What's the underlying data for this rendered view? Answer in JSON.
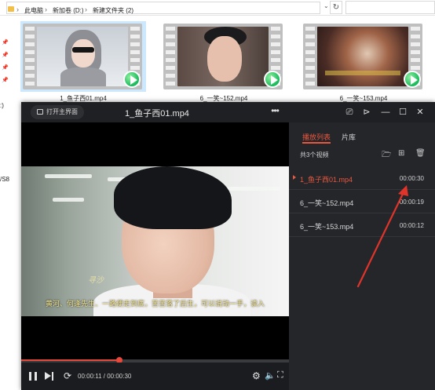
{
  "explorer": {
    "breadcrumbs": [
      "此电脑",
      "新加卷 (D:)",
      "新建文件夹 (2)"
    ],
    "nav_fragments": [
      ":)",
      "/S8"
    ],
    "thumbnails": [
      {
        "label": "1_鱼子西01.mp4",
        "selected": true
      },
      {
        "label": "6_一笑~152.mp4",
        "selected": false
      },
      {
        "label": "6_一笑~153.mp4",
        "selected": false
      }
    ]
  },
  "player": {
    "open_main_label": "打开主界面",
    "title": "1_鱼子西01.mp4",
    "video": {
      "subtitle": "黄河、何逢先生、一路便走到底，苦苦落了后生，可以说动一手，读入",
      "signature": "寻沙"
    },
    "progress": {
      "fraction": 0.367
    },
    "time_text": "00:00:11 / 00:00:30",
    "panel": {
      "tab_playlist": "播放列表",
      "tab_library": "片库",
      "count_text": "共3个视频",
      "items": [
        {
          "name": "1_鱼子西01.mp4",
          "duration": "00:00:30",
          "active": true
        },
        {
          "name": "6_一笑~152.mp4",
          "duration": "00:00:19",
          "active": false
        },
        {
          "name": "6_一笑~153.mp4",
          "duration": "00:00:12",
          "active": false
        }
      ]
    }
  },
  "colors": {
    "accent": "#e8573f",
    "progress": "#e8483b",
    "panel_bg": "#25262a",
    "annotation_arrow": "#e0342b"
  }
}
